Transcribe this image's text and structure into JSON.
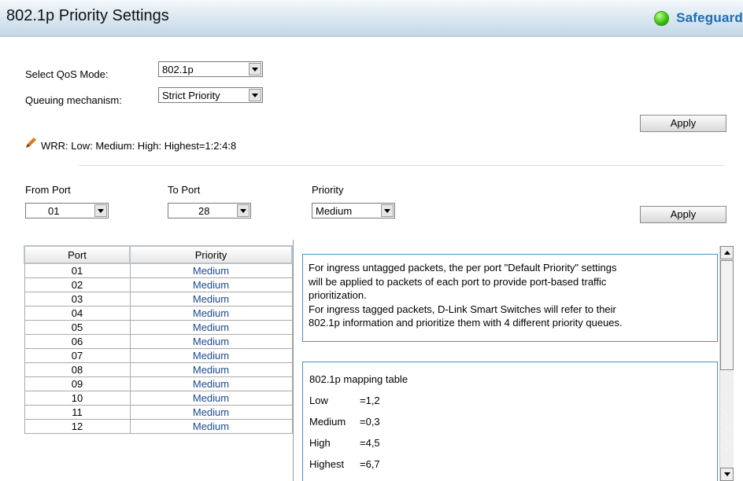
{
  "header": {
    "title": "802.1p Priority Settings",
    "status_label": "Safeguard"
  },
  "qos": {
    "mode_label": "Select QoS Mode:",
    "mode_value": "802.1p",
    "queue_label": "Queuing mechanism:",
    "queue_value": "Strict Priority",
    "apply_label": "Apply",
    "wrr_note": "WRR: Low: Medium: High: Highest=1:2:4:8"
  },
  "port_settings": {
    "from_label": "From Port",
    "from_value": "01",
    "to_label": "To Port",
    "to_value": "28",
    "priority_label": "Priority",
    "priority_value": "Medium",
    "apply_label": "Apply"
  },
  "table": {
    "headers": [
      "Port",
      "Priority"
    ],
    "rows": [
      {
        "port": "01",
        "priority": "Medium"
      },
      {
        "port": "02",
        "priority": "Medium"
      },
      {
        "port": "03",
        "priority": "Medium"
      },
      {
        "port": "04",
        "priority": "Medium"
      },
      {
        "port": "05",
        "priority": "Medium"
      },
      {
        "port": "06",
        "priority": "Medium"
      },
      {
        "port": "07",
        "priority": "Medium"
      },
      {
        "port": "08",
        "priority": "Medium"
      },
      {
        "port": "09",
        "priority": "Medium"
      },
      {
        "port": "10",
        "priority": "Medium"
      },
      {
        "port": "11",
        "priority": "Medium"
      },
      {
        "port": "12",
        "priority": "Medium"
      }
    ]
  },
  "info": {
    "lines": [
      "For ingress untagged packets, the per port \"Default Priority\" settings",
      "will be applied to packets of each port to provide port-based traffic",
      "prioritization.",
      "For ingress tagged packets, D-Link Smart Switches will refer to their",
      "802.1p information and prioritize them with 4 different priority queues."
    ]
  },
  "mapping": {
    "title": "802.1p mapping table",
    "rows": [
      {
        "name": "Low",
        "value": "=1,2"
      },
      {
        "name": "Medium",
        "value": "=0,3"
      },
      {
        "name": "High",
        "value": "=4,5"
      },
      {
        "name": "Highest",
        "value": "=6,7"
      }
    ]
  },
  "colors": {
    "status_green": "#2fb800",
    "accent_blue": "#1f6db3",
    "priority_text": "#1b4a8f"
  }
}
